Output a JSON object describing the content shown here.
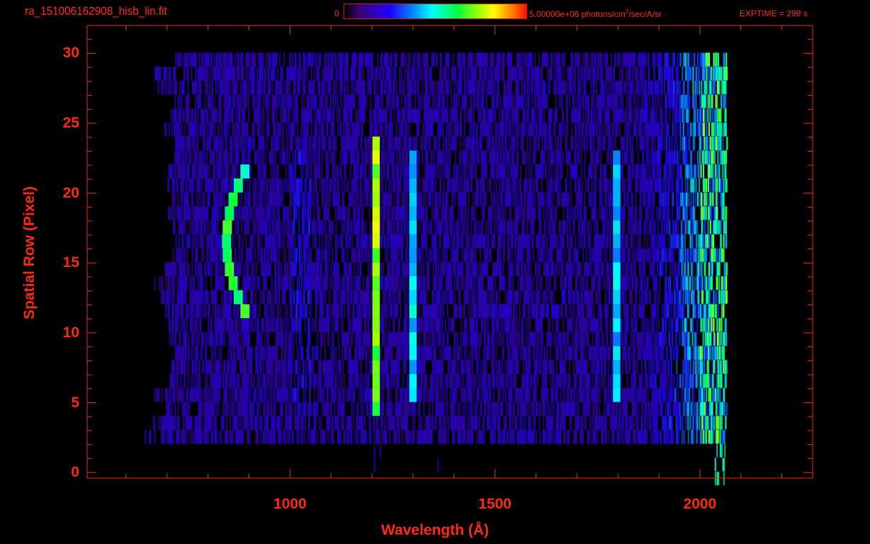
{
  "header": {
    "title": "ra_151006162908_hisb_lin.fit",
    "colorbar_min": "0",
    "colorbar_max": "5.00000e+06 photons/cm",
    "colorbar_sup": "2",
    "colorbar_units_tail": "/sec/A/sr",
    "exptime": "EXPTIME = 299 s"
  },
  "colors": {
    "axis": "#ff2a10",
    "background": "#000000"
  },
  "chart_data": {
    "type": "heatmap",
    "title": "ra_151006162908_hisb_lin.fit",
    "xlabel": "Wavelength (Å)",
    "ylabel": "Spatial Row (Pixel)",
    "xlim": [
      505,
      2275
    ],
    "ylim": [
      -0.4,
      32
    ],
    "xticks": [
      "1000",
      "1500",
      "2000"
    ],
    "xtick_values": [
      1000,
      1500,
      2000
    ],
    "yticks": [
      "0",
      "5",
      "10",
      "15",
      "20",
      "25",
      "30"
    ],
    "ytick_values": [
      0,
      5,
      10,
      15,
      20,
      25,
      30
    ],
    "colormap": "rainbow",
    "color_range": [
      0,
      5000000
    ],
    "data_extent": {
      "wavelength": [
        680,
        2065
      ],
      "rows": [
        3,
        30
      ]
    },
    "features": [
      {
        "name": "curved-line-870",
        "wavelength_center": 845,
        "wavelength_edge": 890,
        "rows": [
          12,
          22
        ],
        "intensity": 0.6
      },
      {
        "name": "line-1216",
        "wavelength_center": 1210,
        "rows": [
          5,
          24
        ],
        "intensity": 0.72
      },
      {
        "name": "line-1304",
        "wavelength_center": 1300,
        "rows": [
          6,
          23
        ],
        "intensity": 0.45
      },
      {
        "name": "line-1800",
        "wavelength_center": 1797,
        "rows": [
          6,
          23
        ],
        "intensity": 0.42
      },
      {
        "name": "red-edge-2050",
        "wavelength_center": 2045,
        "rows": [
          0,
          30
        ],
        "intensity": 0.6
      }
    ]
  }
}
